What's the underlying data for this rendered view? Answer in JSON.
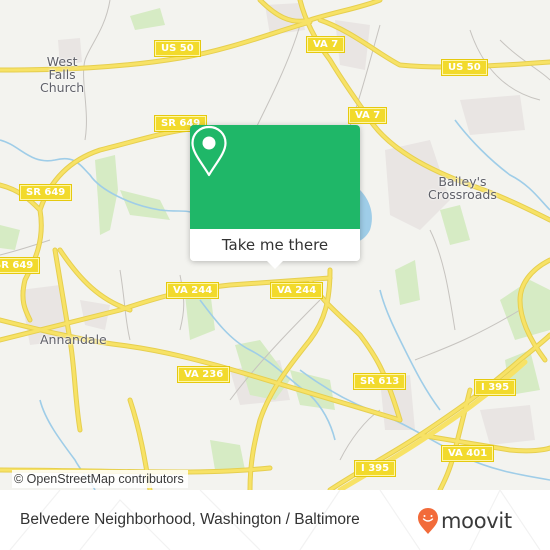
{
  "map": {
    "places": [
      {
        "id": "west-falls-church",
        "lines": [
          "West",
          "Falls",
          "Church"
        ]
      },
      {
        "id": "baileys-crossroads",
        "lines": [
          "Bailey's",
          "Crossroads"
        ]
      },
      {
        "id": "annandale",
        "lines": [
          "Annandale"
        ]
      }
    ],
    "shields": [
      {
        "id": "us50-west",
        "label": "US 50"
      },
      {
        "id": "us50-east",
        "label": "US 50"
      },
      {
        "id": "va7-north",
        "label": "VA 7"
      },
      {
        "id": "va7-south",
        "label": "VA 7"
      },
      {
        "id": "sr649-a",
        "label": "SR 649"
      },
      {
        "id": "sr649-b",
        "label": "SR 649"
      },
      {
        "id": "sr649-c",
        "label": "SR 649"
      },
      {
        "id": "va244-west",
        "label": "VA 244"
      },
      {
        "id": "va244-east",
        "label": "VA 244"
      },
      {
        "id": "va236",
        "label": "VA 236"
      },
      {
        "id": "sr613",
        "label": "SR 613"
      },
      {
        "id": "i395-east",
        "label": "I 395"
      },
      {
        "id": "i395-south",
        "label": "I 395"
      },
      {
        "id": "va401",
        "label": "VA 401"
      }
    ],
    "attribution": "© OpenStreetMap contributors"
  },
  "popup": {
    "icon": "location-pin-icon",
    "action_label": "Take me there",
    "accent_color": "#1fb768"
  },
  "footer": {
    "title": "Belvedere Neighborhood, Washington / Baltimore",
    "brand": "moovit",
    "brand_color": "#f26b3a"
  }
}
